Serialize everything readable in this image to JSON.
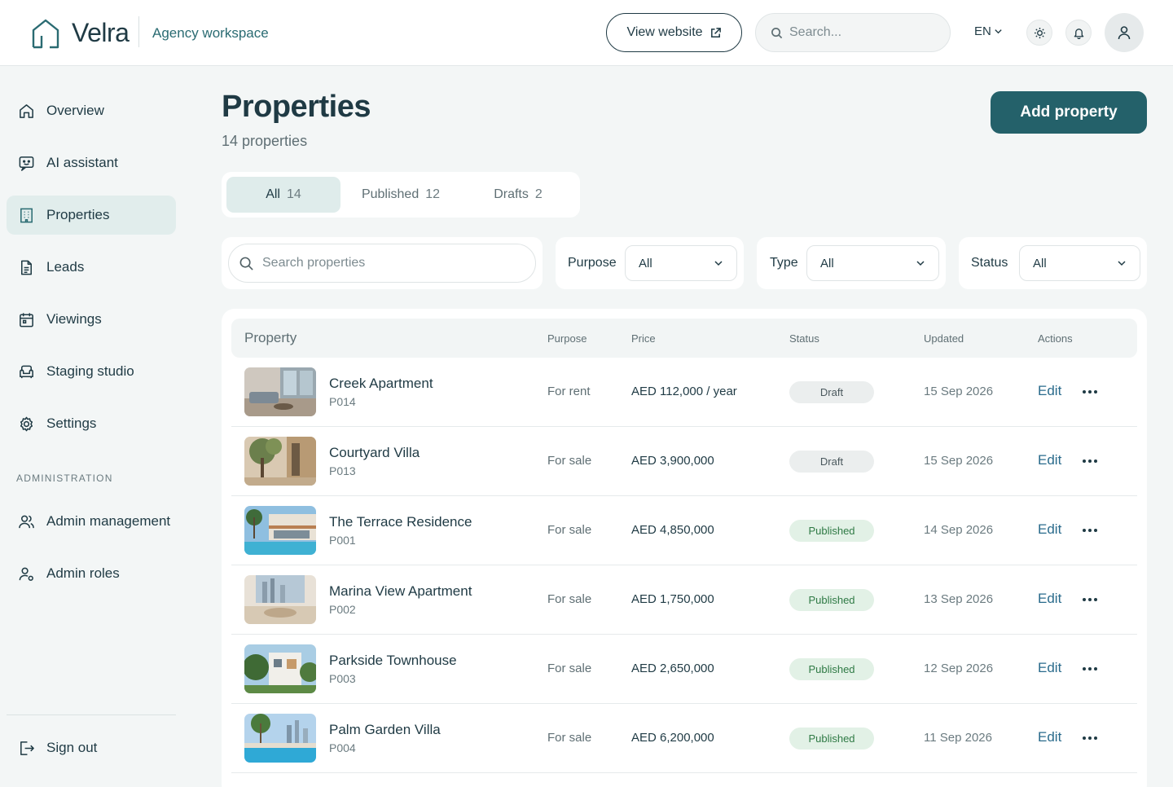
{
  "header": {
    "brand": "Velra",
    "workspace": "Agency workspace",
    "view_website": "View website",
    "search_placeholder": "Search...",
    "language": "EN"
  },
  "sidebar": {
    "items": [
      {
        "label": "Overview",
        "icon": "home-icon"
      },
      {
        "label": "AI assistant",
        "icon": "chat-bot-icon"
      },
      {
        "label": "Properties",
        "icon": "building-icon",
        "active": true
      },
      {
        "label": "Leads",
        "icon": "document-icon"
      },
      {
        "label": "Viewings",
        "icon": "calendar-icon"
      },
      {
        "label": "Staging studio",
        "icon": "sofa-icon"
      },
      {
        "label": "Settings",
        "icon": "gear-icon"
      }
    ],
    "admin_heading": "ADMINISTRATION",
    "admin_items": [
      {
        "label": "Admin management",
        "icon": "users-icon"
      },
      {
        "label": "Admin roles",
        "icon": "user-role-icon"
      }
    ],
    "sign_out": "Sign out"
  },
  "main": {
    "title": "Properties",
    "count": "14 properties",
    "add_button": "Add property",
    "tabs": [
      {
        "label": "All",
        "count": "14"
      },
      {
        "label": "Published",
        "count": "12"
      },
      {
        "label": "Drafts",
        "count": "2"
      }
    ],
    "filters": {
      "search_placeholder": "Search properties",
      "purpose_label": "Purpose",
      "purpose_value": "All",
      "type_label": "Type",
      "type_value": "All",
      "status_label": "Status",
      "status_value": "All"
    },
    "table": {
      "columns": [
        "Property",
        "Purpose",
        "Price",
        "Status",
        "Updated",
        "Actions"
      ],
      "edit_label": "Edit",
      "rows": [
        {
          "name": "Creek Apartment",
          "code": "P014",
          "purpose": "For rent",
          "price": "AED 112,000 / year",
          "status": "Draft",
          "updated": "15 Sep 2026"
        },
        {
          "name": "Courtyard Villa",
          "code": "P013",
          "purpose": "For sale",
          "price": "AED 3,900,000",
          "status": "Draft",
          "updated": "15 Sep 2026"
        },
        {
          "name": "The Terrace Residence",
          "code": "P001",
          "purpose": "For sale",
          "price": "AED 4,850,000",
          "status": "Published",
          "updated": "14 Sep 2026"
        },
        {
          "name": "Marina View Apartment",
          "code": "P002",
          "purpose": "For sale",
          "price": "AED 1,750,000",
          "status": "Published",
          "updated": "13 Sep 2026"
        },
        {
          "name": "Parkside Townhouse",
          "code": "P003",
          "purpose": "For sale",
          "price": "AED 2,650,000",
          "status": "Published",
          "updated": "12 Sep 2026"
        },
        {
          "name": "Palm Garden Villa",
          "code": "P004",
          "purpose": "For sale",
          "price": "AED 6,200,000",
          "status": "Published",
          "updated": "11 Sep 2026"
        }
      ]
    }
  },
  "colors": {
    "primary": "#24616a",
    "text": "#1f3a44",
    "active_bg": "#e1edec",
    "published_bg": "#e2f1e6",
    "published_text": "#2f7a45",
    "draft_bg": "#ebeeee"
  }
}
